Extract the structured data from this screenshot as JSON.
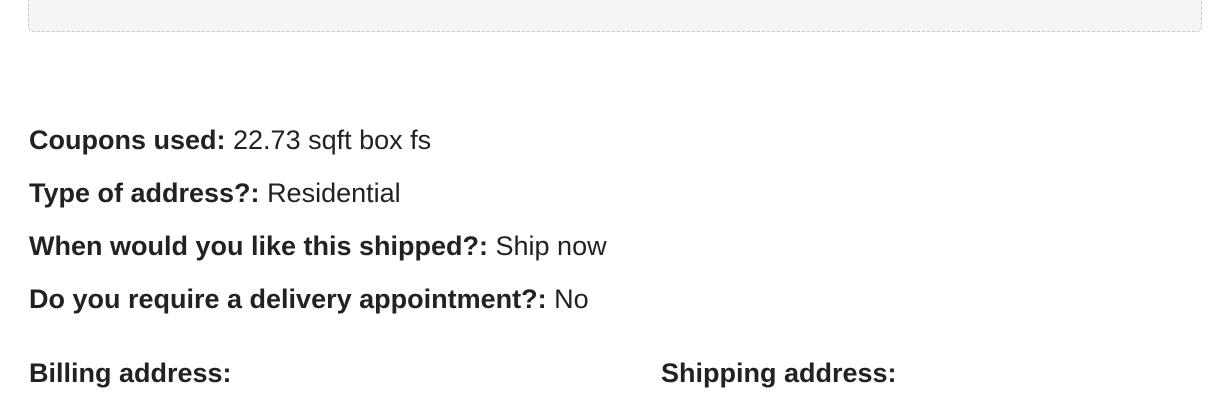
{
  "order_meta": [
    {
      "label": "Coupons used:",
      "value": "22.73 sqft box fs"
    },
    {
      "label": "Type of address?:",
      "value": "Residential"
    },
    {
      "label": "When would you like this shipped?:",
      "value": "Ship now"
    },
    {
      "label": "Do you require a delivery appointment?:",
      "value": "No"
    }
  ],
  "addresses": {
    "billing_heading": "Billing address:",
    "shipping_heading": "Shipping address:"
  }
}
